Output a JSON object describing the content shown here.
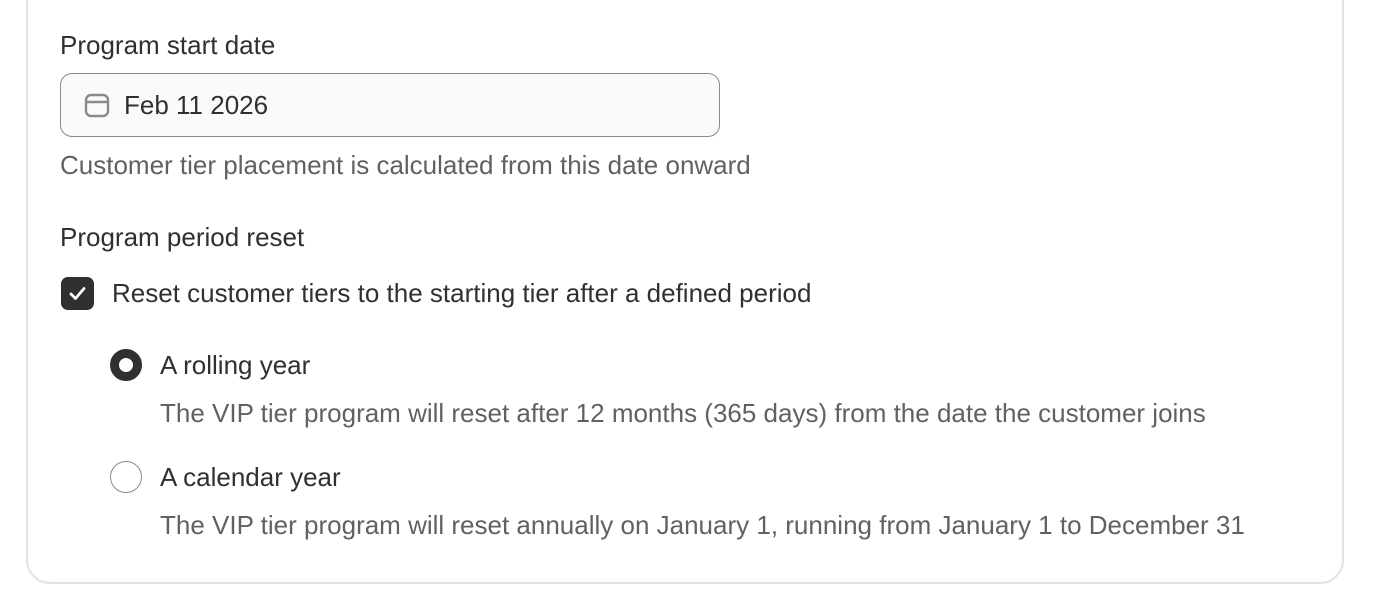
{
  "start_date": {
    "label": "Program start date",
    "value": "Feb 11 2026",
    "icon": "calendar-icon",
    "help_text": "Customer tier placement is calculated from this date onward"
  },
  "period_reset": {
    "label": "Program period reset",
    "checkbox": {
      "checked": true,
      "label": "Reset customer tiers to the starting tier after a defined period"
    },
    "options": [
      {
        "selected": true,
        "label": "A rolling year",
        "description": "The VIP tier program will reset after 12 months (365 days) from the date the customer joins"
      },
      {
        "selected": false,
        "label": "A calendar year",
        "description": "The VIP tier program will reset annually on January 1, running from January 1 to December 31"
      }
    ]
  },
  "colors": {
    "text": "#303030",
    "subdued_text": "#616161",
    "border": "#8a8a8a",
    "card_border": "#e3e3e3",
    "checked_fill": "#303030"
  }
}
